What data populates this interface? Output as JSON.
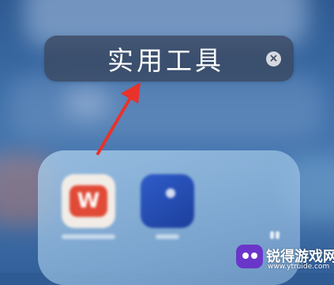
{
  "folder": {
    "title": "实用工具",
    "clear_icon": "x-circle-icon",
    "apps": [
      {
        "icon": "wps-office-app-icon",
        "color": "#e04a36",
        "glyph": "W"
      },
      {
        "icon": "blue-app-icon",
        "color": "#2f5cc9"
      }
    ]
  },
  "annotation": {
    "arrow_color": "#e8322a"
  },
  "watermark": {
    "title": "锐得游戏网",
    "url": "www.ytruide.com",
    "logo_color": "#6a36c9"
  }
}
